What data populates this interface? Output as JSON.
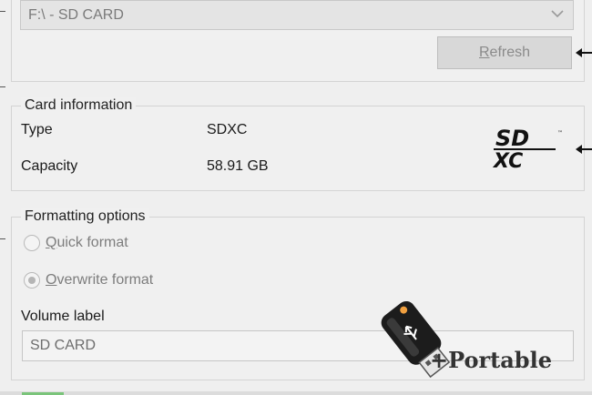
{
  "drive": {
    "selected": "F:\\ - SD CARD"
  },
  "refresh": {
    "label": "Refresh",
    "mnemonic": "R",
    "rest": "efresh"
  },
  "card_info": {
    "legend": "Card information",
    "type_label": "Type",
    "type_value": "SDXC",
    "capacity_label": "Capacity",
    "capacity_value": "58.91 GB",
    "logo": "sdxc-logo"
  },
  "formatting": {
    "legend": "Formatting options",
    "quick": {
      "mnemonic": "Q",
      "rest": "uick format",
      "checked": false
    },
    "overwrite": {
      "mnemonic": "O",
      "rest": "verwrite format",
      "checked": true
    },
    "volume_label_caption": "Volume label",
    "volume_label_value": "SD CARD"
  },
  "watermark": {
    "text": "+Portable",
    "icon": "usb-drive-icon"
  },
  "colors": {
    "disabled_text": "#7d7d7d",
    "button_bg": "#d8d8d8",
    "accent_orange": "#f0a040"
  }
}
